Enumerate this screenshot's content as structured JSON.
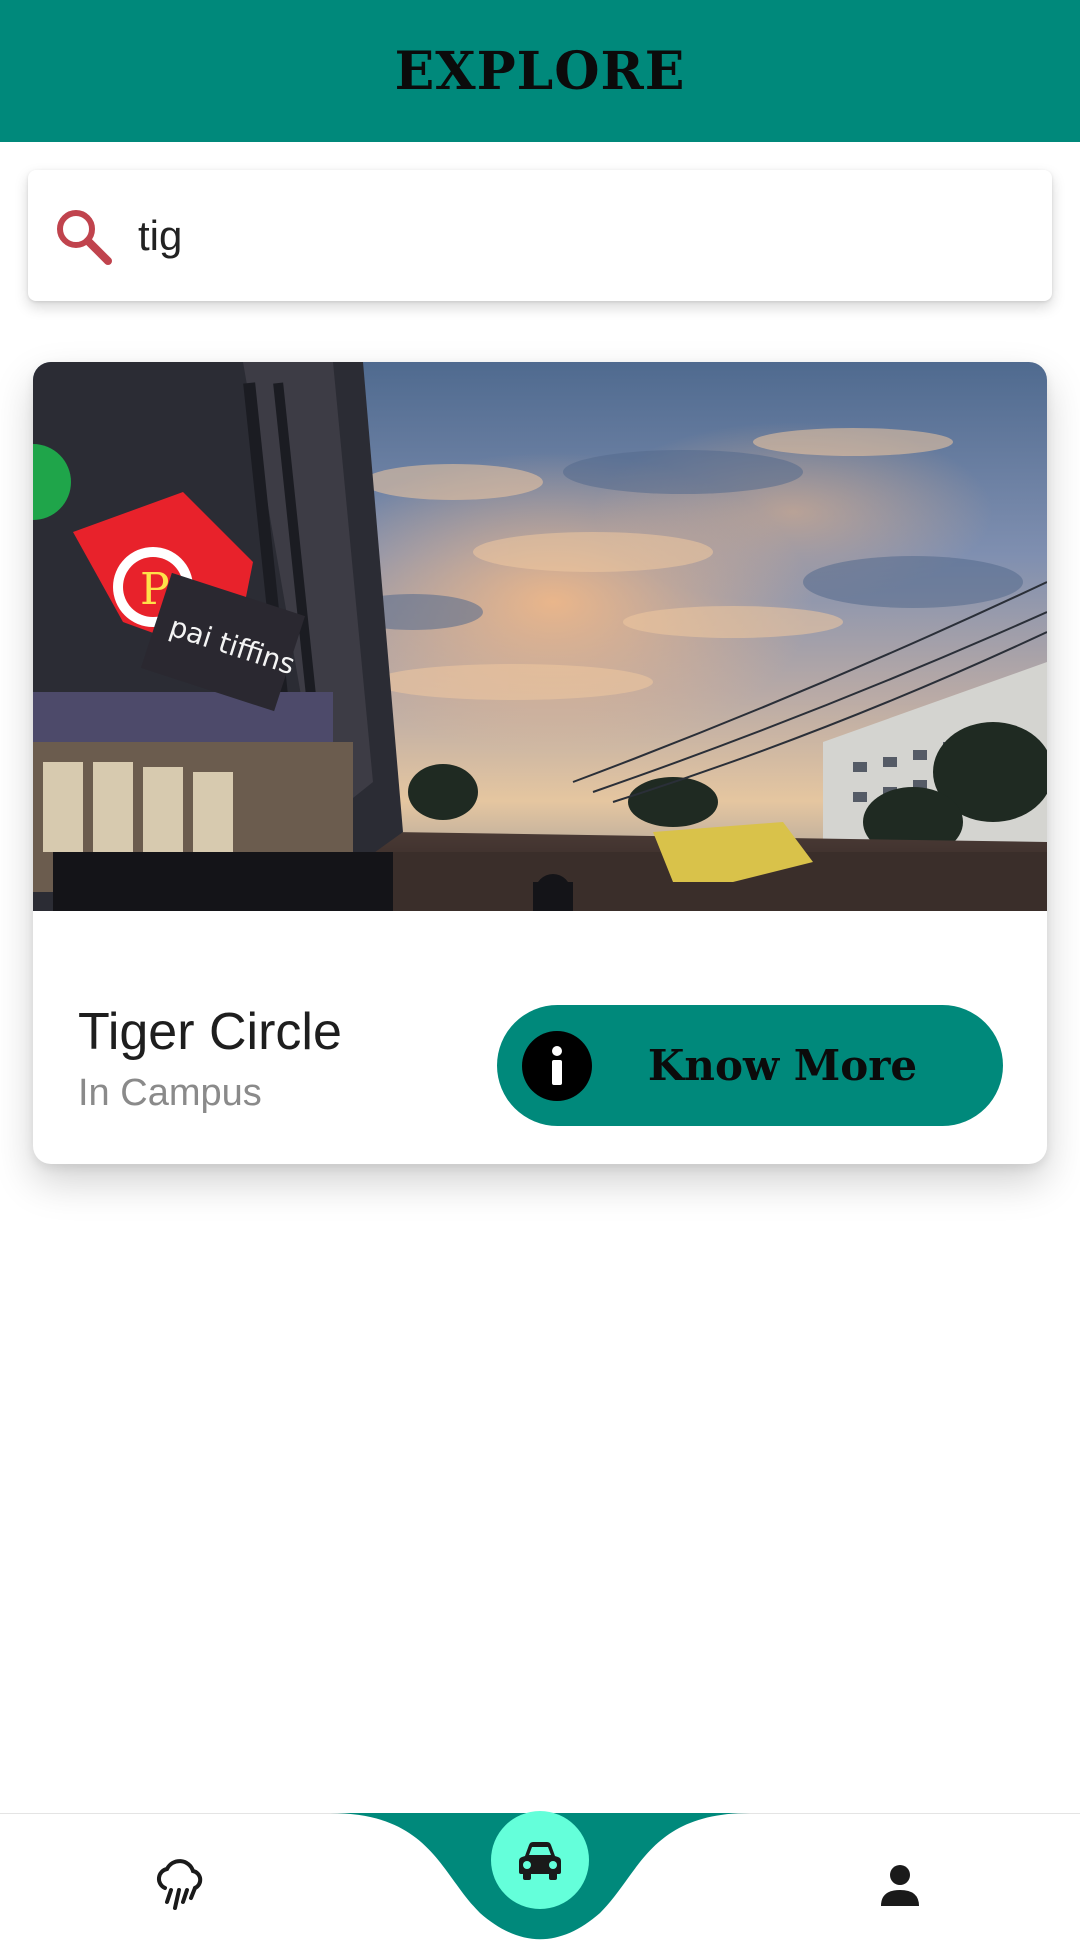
{
  "app_bar": {
    "title": "EXPLORE"
  },
  "search": {
    "value": "tig",
    "icon": "search-icon"
  },
  "result": {
    "name": "Tiger Circle",
    "category": "In Campus",
    "button_label": "Know More",
    "button_icon": "info-icon",
    "photo_sign_text": "pai tiffins"
  },
  "bottom_nav": {
    "items": [
      {
        "icon": "weather-rain-icon"
      },
      {
        "icon": "car-icon",
        "active": true
      },
      {
        "icon": "person-icon"
      }
    ]
  },
  "colors": {
    "primary": "#00897b",
    "accent": "#64ffda",
    "search_icon": "#c0434d"
  }
}
